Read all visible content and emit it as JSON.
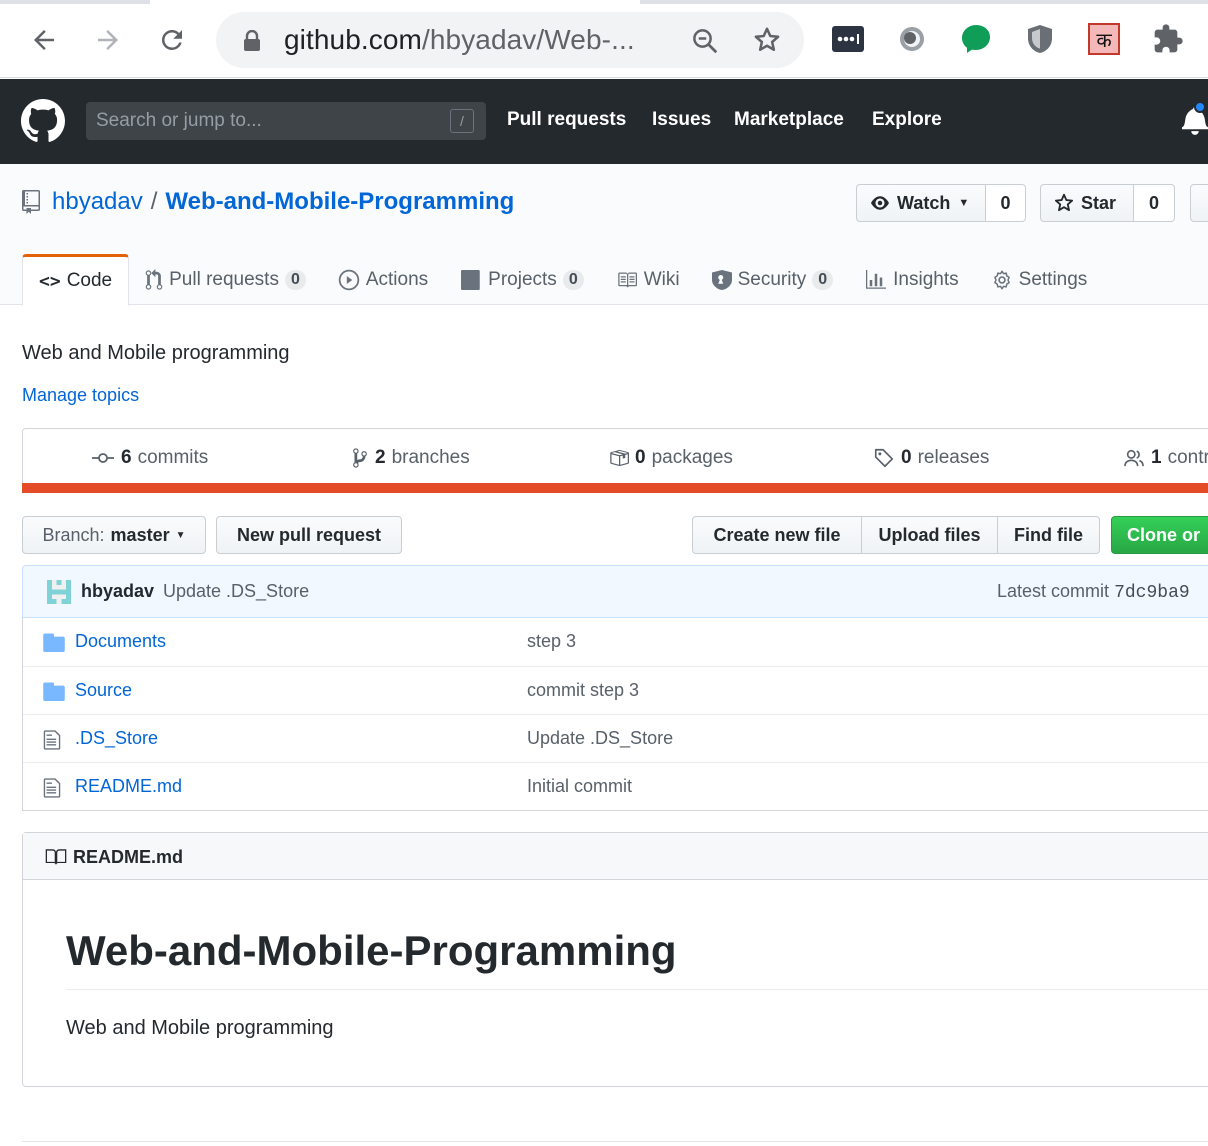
{
  "browser": {
    "url_host": "github.com",
    "url_path": "/hbyadav/Web-...",
    "extensions": [
      "password-manager-icon",
      "reader-icon",
      "chat-icon",
      "shield-icon",
      "hindi-ka-icon",
      "puzzle-icon"
    ],
    "ka_glyph": "क"
  },
  "github": {
    "search_placeholder": "Search or jump to...",
    "search_shortcut": "/",
    "nav": [
      "Pull requests",
      "Issues",
      "Marketplace",
      "Explore"
    ]
  },
  "repo": {
    "owner": "hbyadav",
    "separator": "/",
    "name": "Web-and-Mobile-Programming",
    "watch_label": "Watch",
    "watch_count": "0",
    "star_label": "Star",
    "star_count": "0",
    "tabs": [
      {
        "label": "Code",
        "count": ""
      },
      {
        "label": "Pull requests",
        "count": "0"
      },
      {
        "label": "Actions",
        "count": ""
      },
      {
        "label": "Projects",
        "count": "0"
      },
      {
        "label": "Wiki",
        "count": ""
      },
      {
        "label": "Security",
        "count": "0"
      },
      {
        "label": "Insights",
        "count": ""
      },
      {
        "label": "Settings",
        "count": ""
      }
    ],
    "description": "Web and Mobile programming",
    "manage_topics": "Manage topics",
    "summary": {
      "commits_num": "6",
      "commits_label": "commits",
      "branches_num": "2",
      "branches_label": "branches",
      "packages_num": "0",
      "packages_label": "packages",
      "releases_num": "0",
      "releases_label": "releases",
      "contributors_num": "1",
      "contributors_label": "contr"
    },
    "language_color": "#e34c26"
  },
  "filenav": {
    "branch_prefix": "Branch:",
    "branch_name": "master",
    "new_pr": "New pull request",
    "create_file": "Create new file",
    "upload": "Upload files",
    "find": "Find file",
    "clone": "Clone or"
  },
  "commit": {
    "author": "hbyadav",
    "message": "Update .DS_Store",
    "latest_label": "Latest commit",
    "sha": "7dc9ba9"
  },
  "files": [
    {
      "type": "folder",
      "name": "Documents",
      "message": "step 3"
    },
    {
      "type": "folder",
      "name": "Source",
      "message": "commit step 3"
    },
    {
      "type": "file",
      "name": ".DS_Store",
      "message": "Update .DS_Store"
    },
    {
      "type": "file",
      "name": "README.md",
      "message": "Initial commit"
    }
  ],
  "readme": {
    "filename": "README.md",
    "heading": "Web-and-Mobile-Programming",
    "text": "Web and Mobile programming"
  }
}
